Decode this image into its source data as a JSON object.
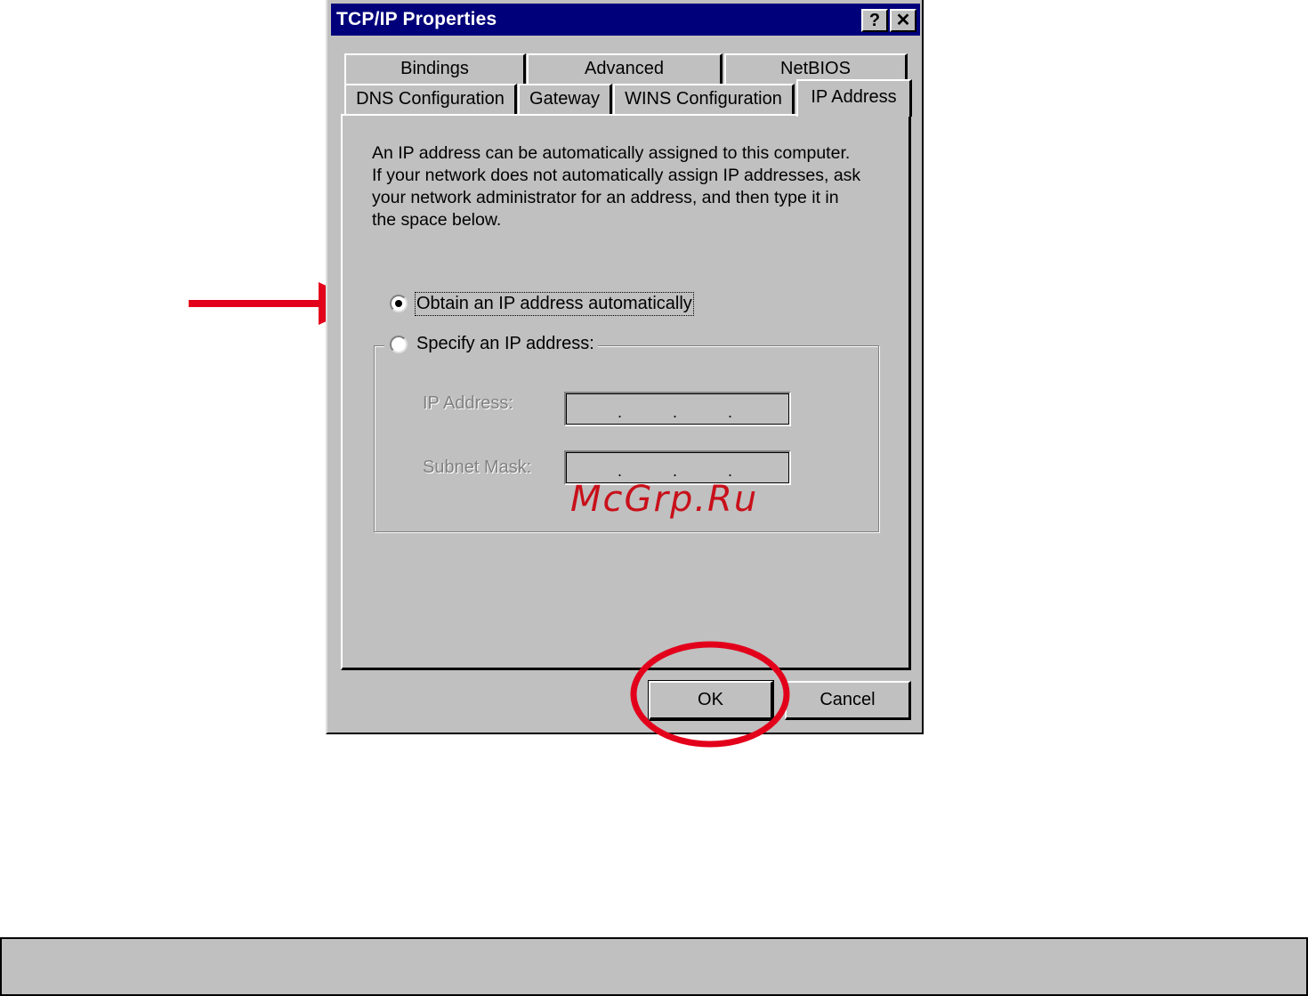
{
  "dialog": {
    "title": "TCP/IP Properties",
    "help_label": "?",
    "close_label": "✕"
  },
  "tabs": {
    "back_row": [
      "Bindings",
      "Advanced",
      "NetBIOS"
    ],
    "front_row": [
      "DNS Configuration",
      "Gateway",
      "WINS Configuration",
      "IP Address"
    ],
    "active": "IP Address"
  },
  "description": [
    "An IP address can be automatically assigned to this computer.",
    "If your network does not automatically assign IP addresses, ask",
    "your network administrator for an address, and then type it in",
    "the space below."
  ],
  "options": {
    "obtain_auto": {
      "label": "Obtain an IP address automatically",
      "selected": true
    },
    "specify": {
      "label": "Specify an IP address:",
      "selected": false
    }
  },
  "fields": {
    "ip_address_label": "IP Address:",
    "subnet_mask_label": "Subnet Mask:",
    "separator": "."
  },
  "buttons": {
    "ok": "OK",
    "cancel": "Cancel"
  },
  "watermark": "McGrp.Ru",
  "colors": {
    "titlebar": "#00007b",
    "face": "#c0c0c0",
    "annotation": "#e3001b"
  },
  "annotations": {
    "arrow": "arrow pointing to obtain automatically option",
    "circle": "circle around OK button"
  }
}
